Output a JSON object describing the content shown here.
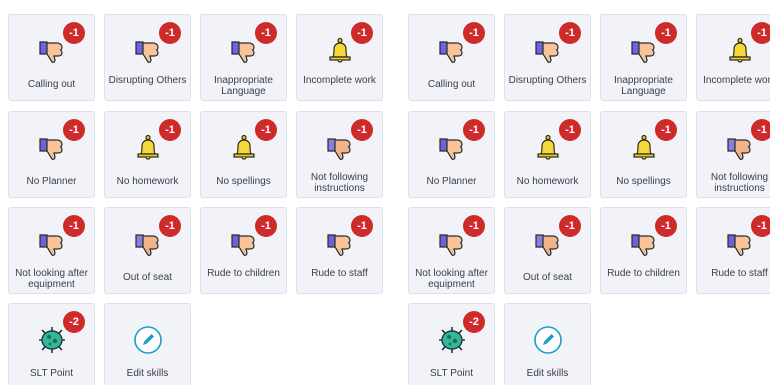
{
  "colors": {
    "badge": "#cf2a2a",
    "card_bg": "#f2f3f9",
    "card_border": "#dcdfec",
    "accent": "#1aa0c9"
  },
  "cards": [
    {
      "label": "Calling out",
      "points": "-1",
      "icon": "thumbs-down-purple-icon"
    },
    {
      "label": "Disrupting Others",
      "points": "-1",
      "icon": "thumbs-down-purple-icon"
    },
    {
      "label": "Inappropriate Language",
      "points": "-1",
      "icon": "thumbs-down-purple-icon"
    },
    {
      "label": "Incomplete work",
      "points": "-1",
      "icon": "bell-icon"
    },
    {
      "label": "No Planner",
      "points": "-1",
      "icon": "thumbs-down-purple-icon"
    },
    {
      "label": "No homework",
      "points": "-1",
      "icon": "bell-icon"
    },
    {
      "label": "No spellings",
      "points": "-1",
      "icon": "bell-icon"
    },
    {
      "label": "Not following instructions",
      "points": "-1",
      "icon": "thumbs-down-peach-icon"
    },
    {
      "label": "Not looking after equipment",
      "points": "-1",
      "icon": "thumbs-down-purple-icon"
    },
    {
      "label": "Out of seat",
      "points": "-1",
      "icon": "thumbs-down-peach-icon"
    },
    {
      "label": "Rude to children",
      "points": "-1",
      "icon": "thumbs-down-purple-icon"
    },
    {
      "label": "Rude to staff",
      "points": "-1",
      "icon": "thumbs-down-purple-icon"
    },
    {
      "label": "SLT Point",
      "points": "-2",
      "icon": "virus-icon"
    },
    {
      "label": "Edit skills",
      "points": null,
      "icon": "pencil-circle-icon"
    }
  ]
}
